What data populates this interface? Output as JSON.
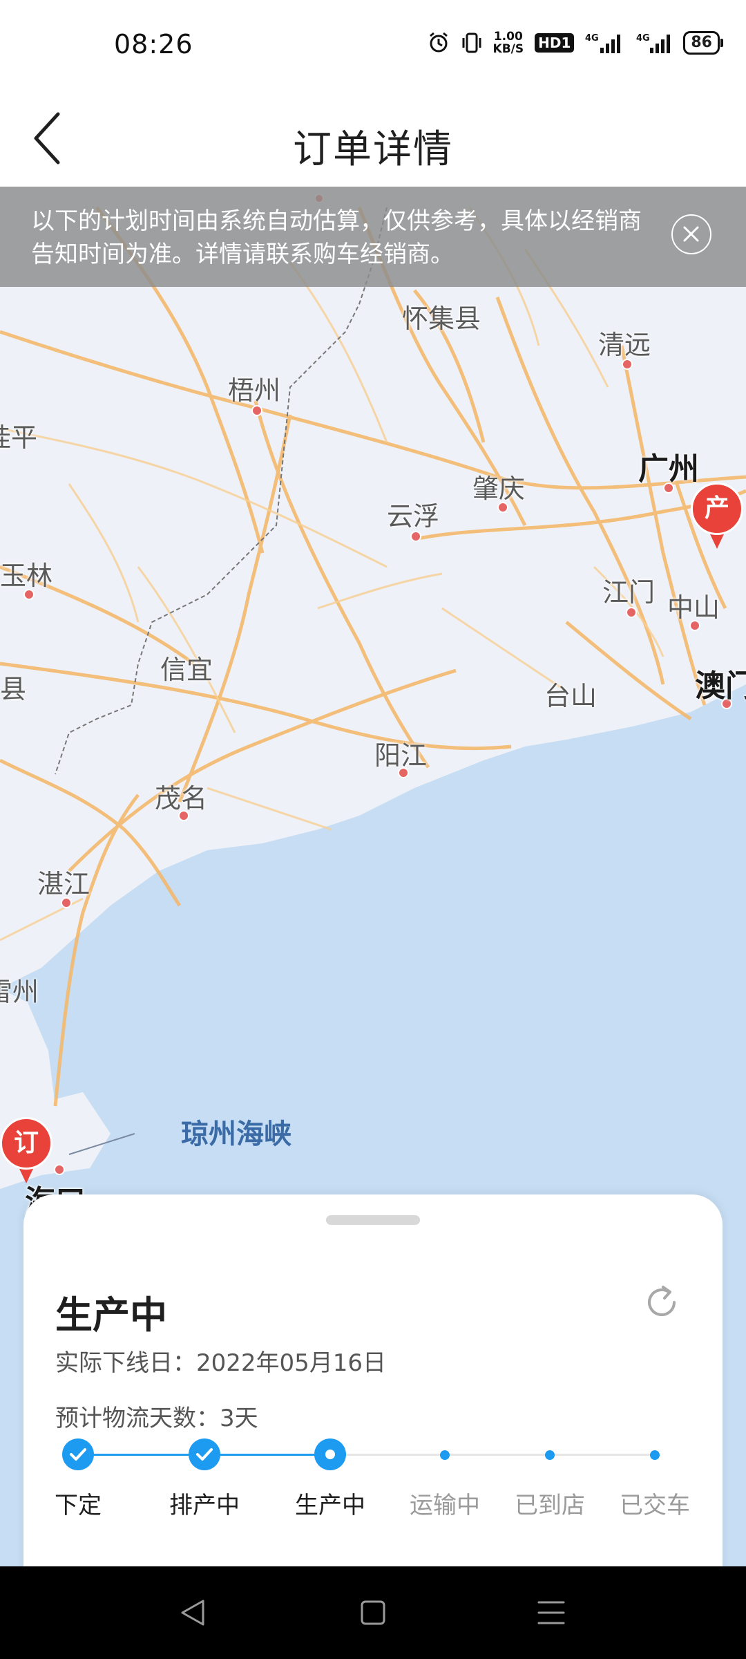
{
  "status_bar": {
    "time": "08:26",
    "net_speed_top": "1.00",
    "net_speed_unit": "KB/S",
    "hd_label": "HD1",
    "signal1": "4G",
    "signal2": "4G",
    "battery": "86"
  },
  "header": {
    "title": "订单详情"
  },
  "notice": {
    "text": "以下的计划时间由系统自动估算，仅供参考，具体以经销商告知时间为准。详情请联系购车经销商。"
  },
  "map": {
    "cities": [
      {
        "name": "怀集县",
        "id": "huaiji"
      },
      {
        "name": "清远",
        "id": "qingyuan"
      },
      {
        "name": "梧州",
        "id": "wuzhou"
      },
      {
        "name": "桂平",
        "id": "guiping",
        "text": "桂平"
      },
      {
        "name": "广州",
        "id": "guangzhou"
      },
      {
        "name": "肇庆",
        "id": "zhaoqing"
      },
      {
        "name": "云浮",
        "id": "yunfu"
      },
      {
        "name": "玉林",
        "id": "yulin"
      },
      {
        "name": "江门",
        "id": "jiangmen"
      },
      {
        "name": "中山",
        "id": "zhongshan"
      },
      {
        "name": "信宜",
        "id": "xinyi"
      },
      {
        "name": "县",
        "id": "xian"
      },
      {
        "name": "台山",
        "id": "taishan"
      },
      {
        "name": "澳门",
        "id": "aomen"
      },
      {
        "name": "阳江",
        "id": "yangjiang"
      },
      {
        "name": "茂名",
        "id": "maoming"
      },
      {
        "name": "湛江",
        "id": "zhanjiang"
      },
      {
        "name": "雷州",
        "id": "leizhou"
      },
      {
        "name": "海口",
        "id": "haikou"
      }
    ],
    "strait": "琼州海峡",
    "marker_production": "产",
    "marker_order": "订"
  },
  "order": {
    "status_title": "生产中",
    "offline_date_label": "实际下线日：",
    "offline_date_value": "2022年05月16日",
    "logistics_label": "预计物流天数：",
    "logistics_value": "3天",
    "steps": [
      {
        "label": "下定",
        "state": "done"
      },
      {
        "label": "排产中",
        "state": "done"
      },
      {
        "label": "生产中",
        "state": "current"
      },
      {
        "label": "运输中",
        "state": "pending"
      },
      {
        "label": "已到店",
        "state": "pending"
      },
      {
        "label": "已交车",
        "state": "pending"
      }
    ],
    "colors": {
      "accent": "#1d9bf0",
      "pending_text": "#9a9a9a",
      "marker": "#e9423a"
    }
  },
  "nav": {
    "back": "back-triangle-icon",
    "home": "home-square-icon",
    "menu": "menu-lines-icon"
  }
}
